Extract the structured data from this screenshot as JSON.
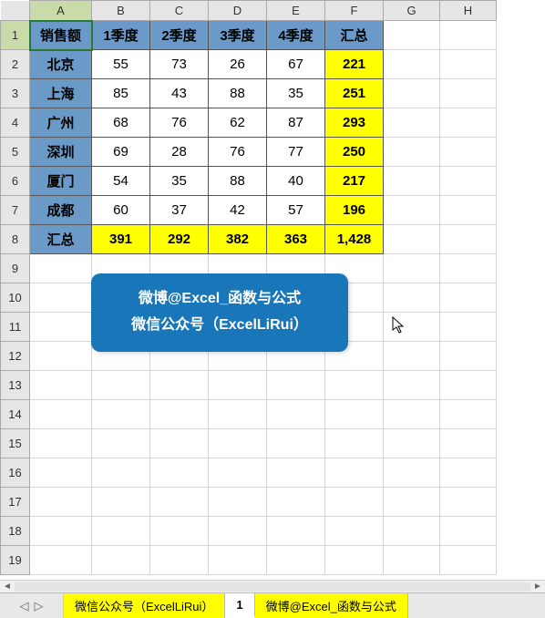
{
  "columns": [
    "A",
    "B",
    "C",
    "D",
    "E",
    "F",
    "G",
    "H"
  ],
  "rowCount": 19,
  "activeCell": "A1",
  "chart_data": {
    "type": "table",
    "title": "销售额",
    "col_headers": [
      "1季度",
      "2季度",
      "3季度",
      "4季度",
      "汇总"
    ],
    "row_headers": [
      "北京",
      "上海",
      "广州",
      "深圳",
      "厦门",
      "成都",
      "汇总"
    ],
    "values": [
      [
        55,
        73,
        26,
        67,
        221
      ],
      [
        85,
        43,
        88,
        35,
        251
      ],
      [
        68,
        76,
        62,
        87,
        293
      ],
      [
        69,
        28,
        76,
        77,
        250
      ],
      [
        54,
        35,
        88,
        40,
        217
      ],
      [
        60,
        37,
        42,
        57,
        196
      ],
      [
        391,
        292,
        382,
        363,
        1428
      ]
    ]
  },
  "grand_total_display": "1,428",
  "callout": {
    "line1": "微博@Excel_函数与公式",
    "line2": "微信公众号（ExcelLiRui）"
  },
  "tabs": {
    "nav_prev": "◁",
    "nav_next": "▷",
    "items": [
      {
        "label": "微信公众号（ExcelLiRui）",
        "yellow": true,
        "active": false
      },
      {
        "label": "1",
        "yellow": false,
        "active": true
      },
      {
        "label": "微博@Excel_函数与公式",
        "yellow": true,
        "active": false
      }
    ]
  },
  "scroll": {
    "left": "◄",
    "right": "►"
  }
}
